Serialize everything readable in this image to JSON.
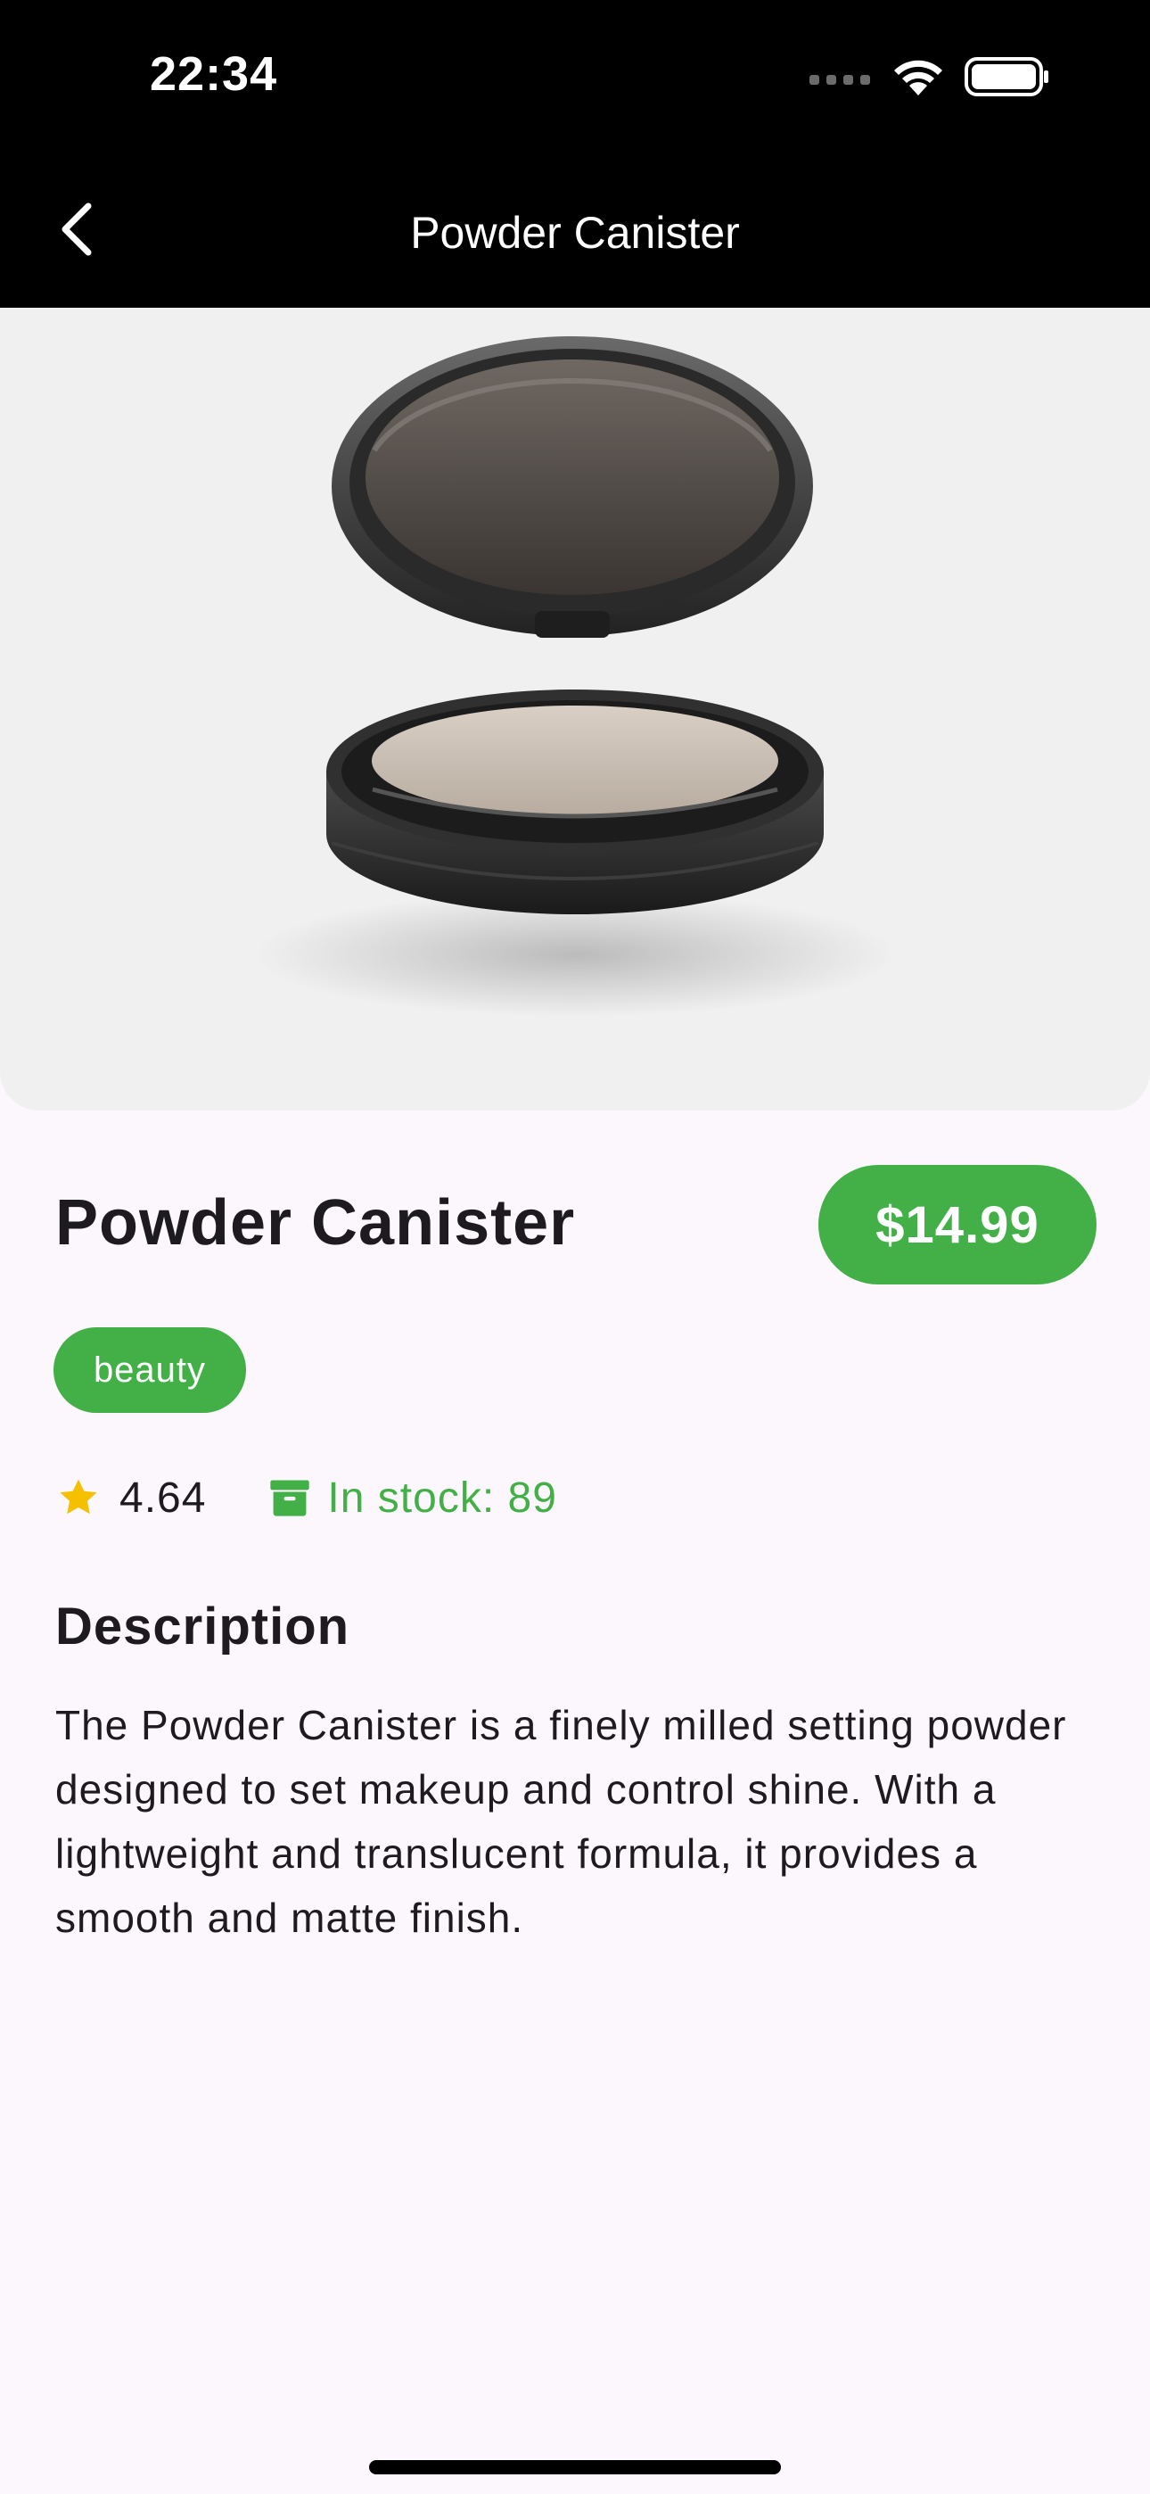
{
  "status_bar": {
    "time": "22:34"
  },
  "app_bar": {
    "title": "Powder Canister",
    "back_icon": "chevron-left-icon"
  },
  "product": {
    "name": "Powder Canister",
    "price": "$14.99",
    "category": "beauty",
    "rating": "4.64",
    "stock_label": "In stock: 89",
    "image_subject": "open compact powder case"
  },
  "description": {
    "heading": "Description",
    "body": "The Powder Canister is a finely milled setting powder designed to set makeup and control shine. With a lightweight and translucent formula, it provides a smooth and matte finish."
  },
  "colors": {
    "accent_green": "#43B047",
    "star_yellow": "#F5C000",
    "background": "#FCF7FD",
    "app_bar": "#000000"
  }
}
